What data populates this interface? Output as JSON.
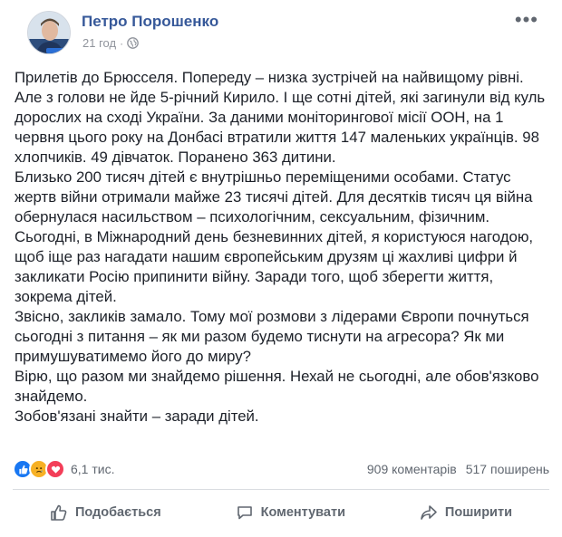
{
  "author": {
    "name": "Петро Порошенко",
    "time": "21 год",
    "separator": "·"
  },
  "post": {
    "paragraphs": [
      "Прилетів до Брюсселя. Попереду – низка зустрічей на найвищому рівні. Але з голови не йде 5-річний Кирило. І ще сотні дітей, які загинули від куль дорослих на сході України. За даними моніторингової місії ООН, на 1 червня цього року на Донбасі втратили життя 147 маленьких українців. 98 хлопчиків. 49 дівчаток. Поранено 363 дитини.",
      "Близько 200 тисяч дітей є внутрішньо переміщеними особами. Статус жертв війни отримали майже 23 тисячі дітей. Для десятків тисяч ця війна обернулася насильством – психологічним, сексуальним, фізичним.",
      "Сьогодні, в Міжнародний день безневинних дітей, я користуюся нагодою, щоб іще раз нагадати нашим європейським друзям ці жахливі цифри й закликати Росію припинити війну. Заради того, щоб зберегти життя, зокрема дітей.",
      "Звісно, закликів замало. Тому мої розмови з лідерами Європи почнуться сьогодні з питання – як ми разом будемо тиснути на агресора? Як ми примушуватимемо його до миру?",
      "Вірю, що разом ми знайдемо рішення. Нехай не сьогодні, але обов'язково знайдемо.",
      "Зобов'язані знайти – заради дітей."
    ]
  },
  "stats": {
    "reactions_count": "6,1 тис.",
    "comments": "909 коментарів",
    "shares": "517 поширень"
  },
  "actions": {
    "like": "Подобається",
    "comment": "Коментувати",
    "share": "Поширити"
  },
  "colors": {
    "name": "#365899",
    "like": "#1877f2",
    "sad": "#f7b125",
    "love": "#f33e58"
  }
}
